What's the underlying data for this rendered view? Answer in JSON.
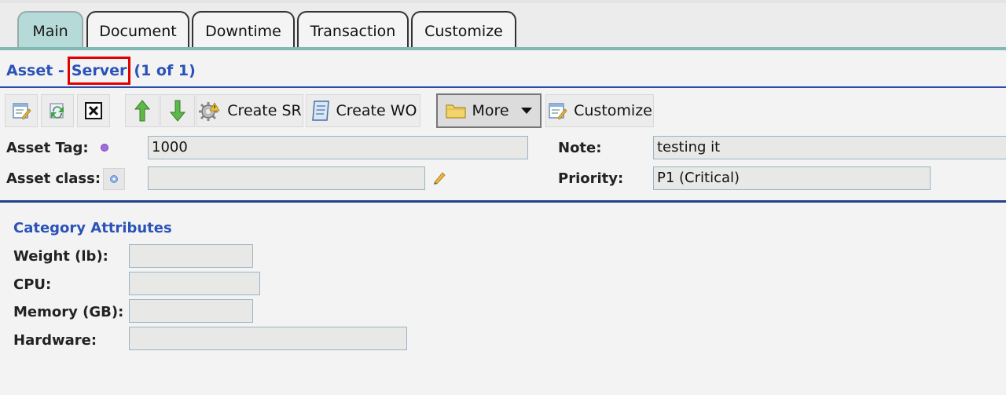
{
  "tabs": [
    {
      "label": "Main",
      "active": true
    },
    {
      "label": "Document",
      "active": false
    },
    {
      "label": "Downtime",
      "active": false
    },
    {
      "label": "Transaction",
      "active": false
    },
    {
      "label": "Customize",
      "active": false
    }
  ],
  "title": {
    "prefix": "Asset -",
    "highlight": "Server",
    "suffix": "(1 of 1)"
  },
  "toolbar": {
    "create_sr": "Create SR",
    "create_wo": "Create WO",
    "more": "More",
    "customize": "Customize"
  },
  "form": {
    "asset_tag_label": "Asset Tag:",
    "asset_tag_value": "1000",
    "asset_class_label": "Asset class:",
    "asset_class_value": "",
    "note_label": "Note:",
    "note_value": "testing it",
    "priority_label": "Priority:",
    "priority_value": "P1 (Critical)"
  },
  "category": {
    "title": "Category Attributes",
    "weight_label": "Weight (lb):",
    "weight_value": "",
    "cpu_label": "CPU:",
    "cpu_value": "",
    "memory_label": "Memory (GB):",
    "memory_value": "",
    "hardware_label": "Hardware:",
    "hardware_value": ""
  },
  "colors": {
    "accent_blue": "#2a52b8",
    "tab_active": "#b6dad7",
    "highlight_box": "#e00000"
  }
}
